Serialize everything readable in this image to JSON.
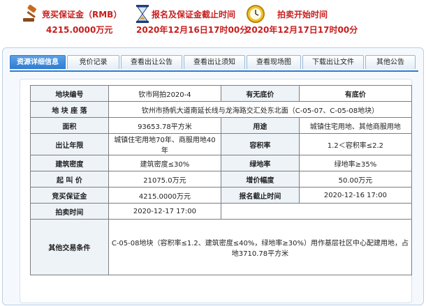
{
  "header": {
    "deposit_label": "竞买保证金（RMB）",
    "deposit_value": "4215.0000万元",
    "deadline_label": "报名及保证金截止时间",
    "deadline_value": "2020年12月16日17时00分",
    "start_label": "拍卖开始时间",
    "start_value": "2020年12月17日17时00分"
  },
  "tabs": [
    {
      "label": "资源详细信息",
      "active": true
    },
    {
      "label": "竞价记录",
      "active": false
    },
    {
      "label": "查看出让公告",
      "active": false
    },
    {
      "label": "查看出让须知",
      "active": false
    },
    {
      "label": "查看现场图",
      "active": false
    },
    {
      "label": "下载出让文件",
      "active": false
    },
    {
      "label": "其他公告",
      "active": false
    }
  ],
  "details": {
    "parcel_no_label": "地块编号",
    "parcel_no": "钦市网拍2020-4",
    "reserve_label": "有无底价",
    "reserve": "有底价",
    "location_label": "地 块 座 落",
    "location": "钦州市扬帆大道南延长线与龙海路交汇处东北面（C-05-07、C-05-08地块）",
    "area_label": "面积",
    "area": "93653.78平方米",
    "use_label": "用途",
    "use": "城镇住宅用地、其他商服用地",
    "term_label": "出让年限",
    "term": "城镇住宅用地70年、商服用地40年",
    "far_label": "容积率",
    "far": "1.2＜容积率≤2.2",
    "density_label": "建筑密度",
    "density": "建筑密度≤30%",
    "green_label": "绿地率",
    "green": "绿地率≥35%",
    "start_price_label": "起 叫 价",
    "start_price": "21075.0万元",
    "increment_label": "增价幅度",
    "increment": "50.00万元",
    "deposit_label": "竞买保证金",
    "deposit": "4215.0000万元",
    "deadline_label": "报名截止时间",
    "deadline": "2020-12-16 17:00",
    "auction_time_label": "拍卖时间",
    "auction_time": "2020-12-17 17:00",
    "other_label": "其他交易条件",
    "other": "C-05-08地块（容积率≤1.2、建筑密度≤40%，绿地率≥30%）用作基层社区中心配建用地，占地3710.78平方米"
  },
  "colors": {
    "accent_red": "#c81d1d",
    "tab_active": "#2f7cd0"
  }
}
